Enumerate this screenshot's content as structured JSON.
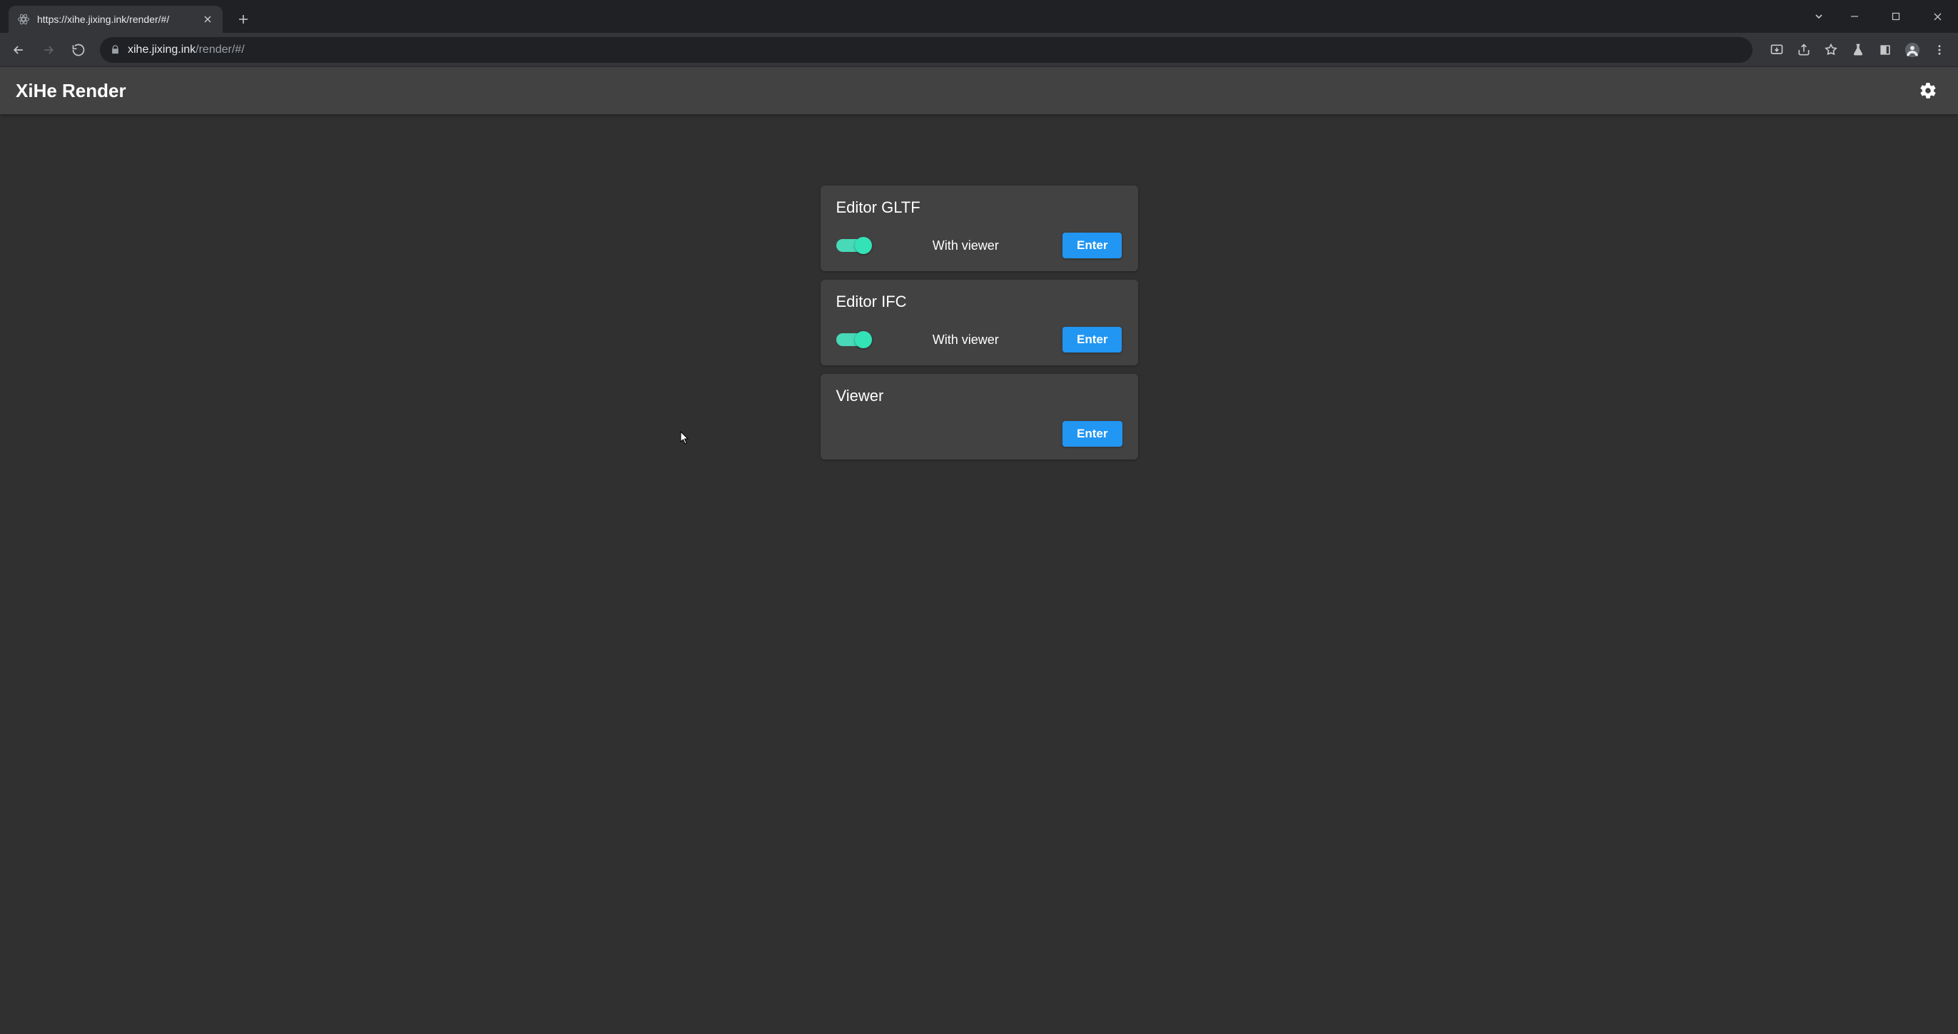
{
  "browser": {
    "tab_title": "https://xihe.jixing.ink/render/#/",
    "url_host": "xihe.jixing.ink",
    "url_path": "/render/#/"
  },
  "app": {
    "title": "XiHe Render"
  },
  "cards": [
    {
      "title": "Editor GLTF",
      "toggle": true,
      "row_label": "With viewer",
      "button": "Enter"
    },
    {
      "title": "Editor IFC",
      "toggle": true,
      "row_label": "With viewer",
      "button": "Enter"
    },
    {
      "title": "Viewer",
      "toggle": false,
      "row_label": "",
      "button": "Enter"
    }
  ]
}
